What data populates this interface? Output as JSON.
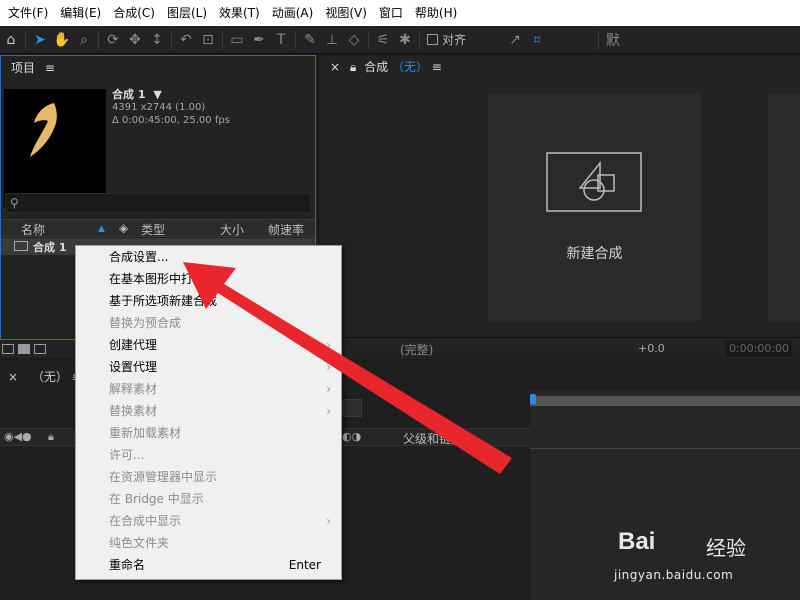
{
  "menu": [
    "文件(F)",
    "编辑(E)",
    "合成(C)",
    "图层(L)",
    "效果(T)",
    "动画(A)",
    "视图(V)",
    "窗口",
    "帮助(H)"
  ],
  "toolbar": {
    "align_label": "对齐",
    "accent_color": "#2d8ceb"
  },
  "project": {
    "title": "项目",
    "comp_name": "合成 1",
    "comp_size": "4391 x2744 (1.00)",
    "comp_duration": "Δ 0:00:45:00, 25.00 fps",
    "search_icon": "search-icon",
    "columns": {
      "name": "名称",
      "type": "类型",
      "size": "大小",
      "fps": "帧速率"
    },
    "row_name": "合成 1"
  },
  "viewer": {
    "title": "合成",
    "none_label": "（无）",
    "new_comp_label": "新建合成",
    "quality": "(完整)",
    "exposure": "+0.0",
    "timecode": "0:00:00:00"
  },
  "timeline": {
    "title": "（无）",
    "parent_col": "父级和链接"
  },
  "context_menu": {
    "items": [
      {
        "label": "合成设置...",
        "enabled": true
      },
      {
        "label": "在基本图形中打开",
        "enabled": true
      },
      {
        "label": "基于所选项新建合成",
        "enabled": true
      },
      {
        "label": "替换为预合成",
        "enabled": false
      },
      {
        "label": "创建代理",
        "enabled": true,
        "submenu": true
      },
      {
        "label": "设置代理",
        "enabled": true,
        "submenu": true
      },
      {
        "label": "解释素材",
        "enabled": false,
        "submenu": true
      },
      {
        "label": "替换素材",
        "enabled": false,
        "submenu": true
      },
      {
        "label": "重新加载素材",
        "enabled": false
      },
      {
        "label": "许可...",
        "enabled": false
      },
      {
        "label": "在资源管理器中显示",
        "enabled": false
      },
      {
        "label": "在 Bridge 中显示",
        "enabled": false
      },
      {
        "label": "在合成中显示",
        "enabled": false,
        "submenu": true
      },
      {
        "label": "纯色文件夹",
        "enabled": false
      },
      {
        "label": "重命名",
        "enabled": true,
        "shortcut": "Enter"
      }
    ]
  },
  "watermark": {
    "logo": "Bai",
    "brand": "经验",
    "url": "jingyan.baidu.com"
  },
  "annotation_color": "#e8262b"
}
